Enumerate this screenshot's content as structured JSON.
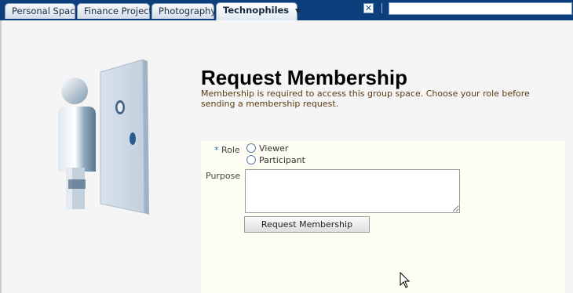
{
  "tabs": [
    {
      "label": "Personal Space"
    },
    {
      "label": "Finance Project"
    },
    {
      "label": "Photography"
    },
    {
      "label": "Technophiles",
      "active": true,
      "caret": "▼"
    }
  ],
  "toolbar": {
    "close_glyph": "✕",
    "search_value": ""
  },
  "page": {
    "title": "Request Membership",
    "description": "Membership is required to access this group space. Choose your role before sending a membership request."
  },
  "form": {
    "role_required_marker": "*",
    "role_label": "Role",
    "role_options": [
      "Viewer",
      "Participant"
    ],
    "purpose_label": "Purpose",
    "purpose_value": "",
    "submit_label": "Request Membership"
  },
  "colors": {
    "topbar": "#0d3f7c",
    "description_text": "#5a3a10",
    "panel_bg": "#fdfdf3"
  }
}
